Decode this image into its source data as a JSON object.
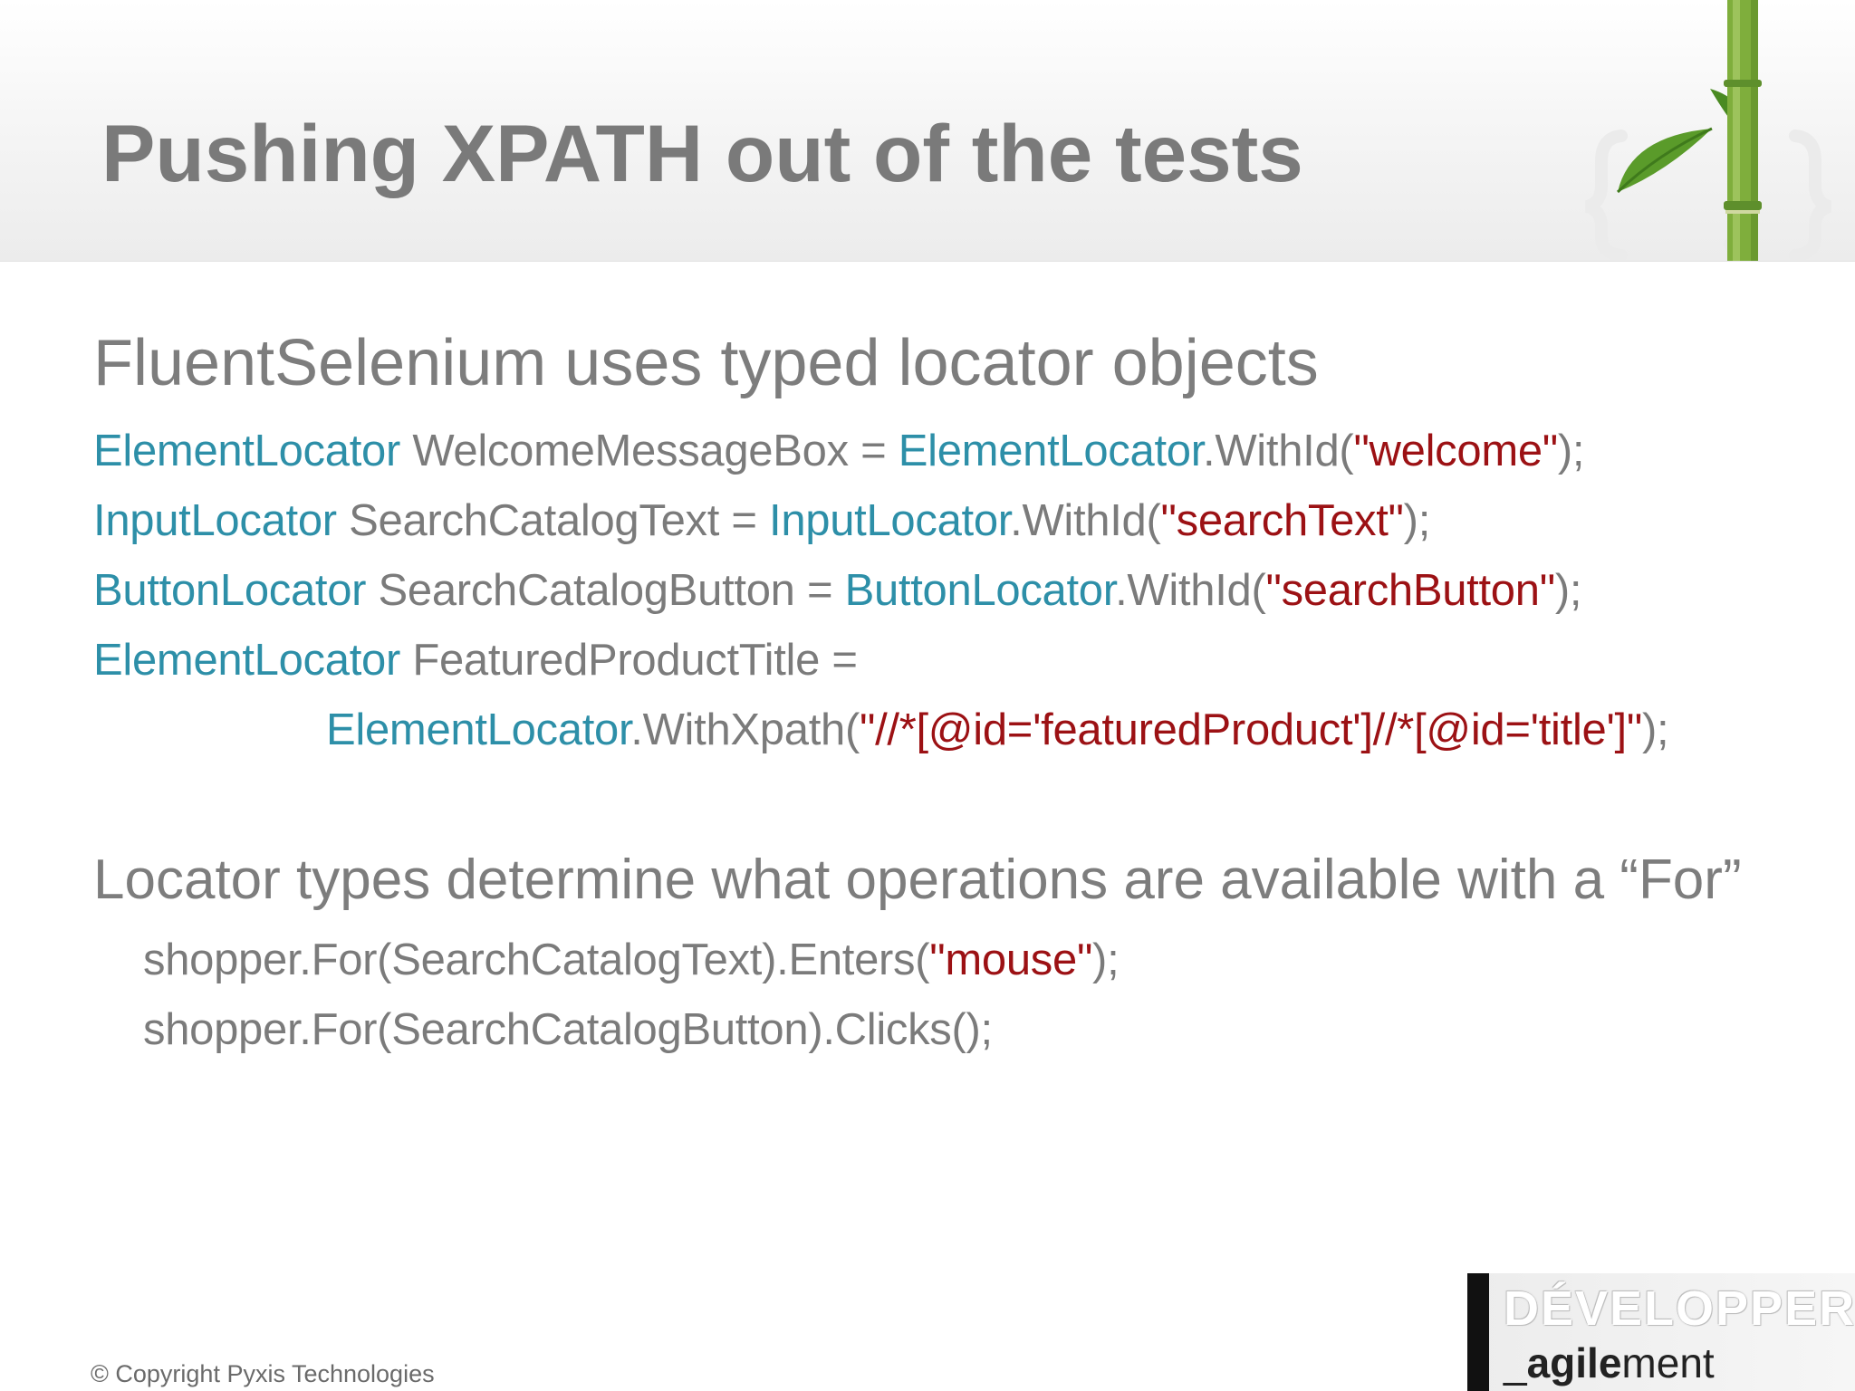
{
  "slide": {
    "title": "Pushing XPATH out of the tests",
    "heading1": "FluentSelenium uses typed locator objects",
    "code_lines": [
      {
        "type": "ElementLocator",
        "var": " WelcomeMessageBox = ",
        "type2": "ElementLocator",
        "method": ".WithId(",
        "arg": "\"welcome\"",
        "end": ");"
      },
      {
        "type": "InputLocator",
        "var": " SearchCatalogText = ",
        "type2": "InputLocator",
        "method": ".WithId(",
        "arg": "\"searchText\"",
        "end": ");"
      },
      {
        "type": "ButtonLocator",
        "var": " SearchCatalogButton = ",
        "type2": "ButtonLocator",
        "method": ".WithId(",
        "arg": "\"searchButton\"",
        "end": ");"
      },
      {
        "type": "ElementLocator",
        "var": " FeaturedProductTitle ="
      }
    ],
    "xpath_line": {
      "type": "ElementLocator",
      "method": ".WithXpath(",
      "arg": "\"//*[@id='featuredProduct']//*[@id='title']\"",
      "end": ");"
    },
    "heading2": "Locator types determine what operations are available with a “For”",
    "for_lines": [
      {
        "pre": "shopper.For(SearchCatalogText).Enters(",
        "arg": "\"mouse\"",
        "end": ");"
      },
      {
        "pre": "shopper.For(SearchCatalogButton).Clicks();"
      }
    ],
    "copyright": "© Copyright Pyxis Technologies",
    "logo": {
      "line1": "DÉVELOPPER",
      "line2_prefix": "_",
      "line2_bold": "agile",
      "line2_rest": "ment"
    }
  },
  "colors": {
    "title": "#7a7a7a",
    "text": "#7b7b7b",
    "type_keyword": "#2d8fa8",
    "string_literal": "#9c1114",
    "bamboo": "#7fae3c"
  },
  "icons": [
    "bamboo-decoration-icon",
    "curly-brace-icon"
  ]
}
